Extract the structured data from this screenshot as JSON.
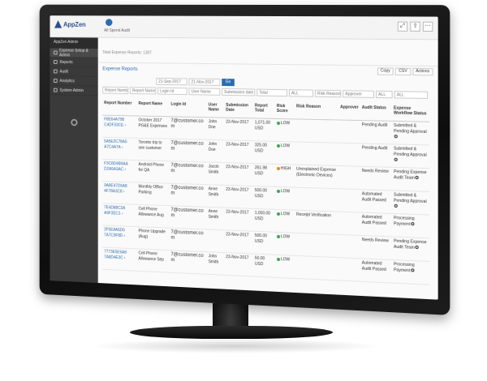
{
  "app": {
    "logo_text": "AppZen"
  },
  "breadcrumb": "All Spend Audit",
  "window_icons": [
    "expand-icon",
    "share-icon",
    "more-icon"
  ],
  "sidebar": {
    "user": "AppZen Admin",
    "items": [
      {
        "label": "Expense Setup & Admin",
        "icon": "gear-icon"
      },
      {
        "label": "Reports",
        "icon": "chart-icon"
      },
      {
        "label": "Audit",
        "icon": "check-icon"
      },
      {
        "label": "Analytics",
        "icon": "analytics-icon"
      },
      {
        "label": "System Admin",
        "icon": "admin-icon"
      }
    ]
  },
  "subheader_text": "Total Expense Reports: 1307",
  "panel": {
    "title": "Expense Reports",
    "buttons": [
      "Copy",
      "CSV",
      "Actions"
    ]
  },
  "filters": {
    "date_from": "21-Sep-2017",
    "date_to": "21-Nov-2017",
    "go_label": "Go",
    "row2": [
      "Report Number",
      "Report Name",
      "Login Id",
      "User Name",
      "Submission date",
      "Total",
      "ALL",
      "Risk Reason",
      "Approver",
      "ALL",
      "ALL"
    ]
  },
  "table": {
    "columns": [
      "Report Number",
      "Report Name",
      "Login Id",
      "User Name",
      "Submission Date",
      "Report Total",
      "Risk Score",
      "Risk Reason",
      "Approver",
      "Audit Status",
      "Expense Workflow Status"
    ],
    "rows": [
      {
        "number": "F8E64A798 C4DF33CE",
        "name": "October 2017 PG&E Expenses",
        "login": "7@customer.co m",
        "user": "John Doe",
        "date": "23-Nov-2017",
        "total": "1,071.00 USD",
        "risk": "LOW",
        "risk_level": "low",
        "reason": "",
        "approver": "",
        "audit": "Pending Audit",
        "workflow": "Submitted & Pending Approval"
      },
      {
        "number": "5A5E2C78A5 A7C4A7A",
        "name": "Toronto trip to see customer",
        "login": "7@customer.co m",
        "user": "John Doe",
        "date": "23-Nov-2017",
        "total": "325.00 USD",
        "risk": "LOW",
        "risk_level": "low",
        "reason": "",
        "approver": "",
        "audit": "Pending Audit",
        "workflow": "Submitted & Pending Approval"
      },
      {
        "number": "F3C8D4B9AA D2A5A3AC",
        "name": "Android Phone for QA",
        "login": "7@customer.co m",
        "user": "Jacob Smith",
        "date": "23-Nov-2017",
        "total": "261.98 USD",
        "risk": "HIGH",
        "risk_level": "high",
        "reason": "Unexplained Expense (Electronic Devices)",
        "approver": "",
        "audit": "Needs Review",
        "workflow": "Pending Expense Audit Team"
      },
      {
        "number": "9A8E47D6A8 4F78A3C8",
        "name": "Monthly Office Parking",
        "login": "7@customer.co m",
        "user": "Anne Smith",
        "date": "23-Nov-2017",
        "total": "500.00 USD",
        "risk": "LOW",
        "risk_level": "low",
        "reason": "",
        "approver": "",
        "audit": "Automated Audit Passed",
        "workflow": "Submitted & Pending Approval"
      },
      {
        "number": "7E4D88C3A A9F3EC1",
        "name": "Cell Phone Allowance Aug",
        "login": "7@customer.co m",
        "user": "Anne Smith",
        "date": "23-Nov-2017",
        "total": "1,050.00 USD",
        "risk": "LOW",
        "risk_level": "low",
        "reason": "Receipt Verification",
        "approver": "",
        "audit": "Automated Audit Passed",
        "workflow": "Processing Payment"
      },
      {
        "number": "2F5E8A5D6 7A7C9F8D",
        "name": "Phone Upgrade (Aug)",
        "login": "7@customer.co m",
        "user": "",
        "date": "23-Nov-2017",
        "total": "500.00 USD",
        "risk": "LOW",
        "risk_level": "low",
        "reason": "",
        "approver": "",
        "audit": "Needs Review",
        "workflow": "Pending Expense Audit Team"
      },
      {
        "number": "7773E5E6A8 7A8D4E3C",
        "name": "Cell Phone Allowance Sep",
        "login": "7@customer.co m",
        "user": "John Smith",
        "date": "23-Nov-2017",
        "total": "50.00 USD",
        "risk": "LOW",
        "risk_level": "low",
        "reason": "",
        "approver": "",
        "audit": "Automated Audit Passed",
        "workflow": "Processing Payment"
      }
    ]
  }
}
